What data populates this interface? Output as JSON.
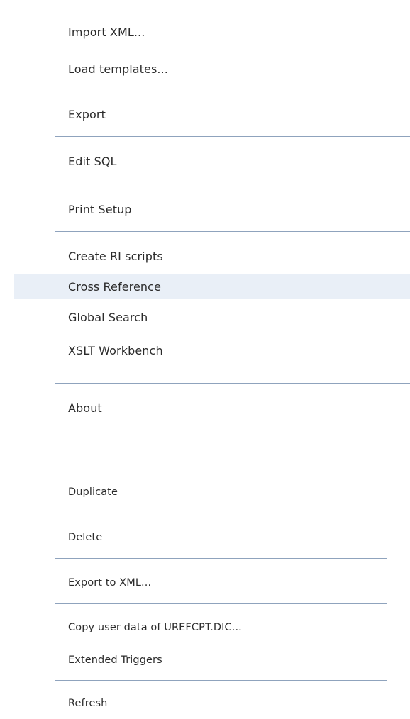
{
  "main_menu": {
    "items": [
      {
        "label": "Import XML..."
      },
      {
        "label": "Load templates..."
      },
      {
        "label": "Export"
      },
      {
        "label": "Edit SQL"
      },
      {
        "label": "Print Setup"
      },
      {
        "label": "Create RI scripts"
      },
      {
        "label": "Cross Reference",
        "highlighted": true
      },
      {
        "label": "Global Search"
      },
      {
        "label": "XSLT Workbench"
      },
      {
        "label": "About"
      }
    ]
  },
  "context_menu": {
    "items": [
      {
        "label": "Duplicate"
      },
      {
        "label": "Delete"
      },
      {
        "label": "Export to XML..."
      },
      {
        "label": "Copy user data of UREFCPT.DIC..."
      },
      {
        "label": "Extended Triggers"
      },
      {
        "label": "Refresh"
      }
    ]
  },
  "colors": {
    "highlight_background": "#e9eff7",
    "highlight_border": "#8ea7c7",
    "separator": "#8fa3bd"
  }
}
